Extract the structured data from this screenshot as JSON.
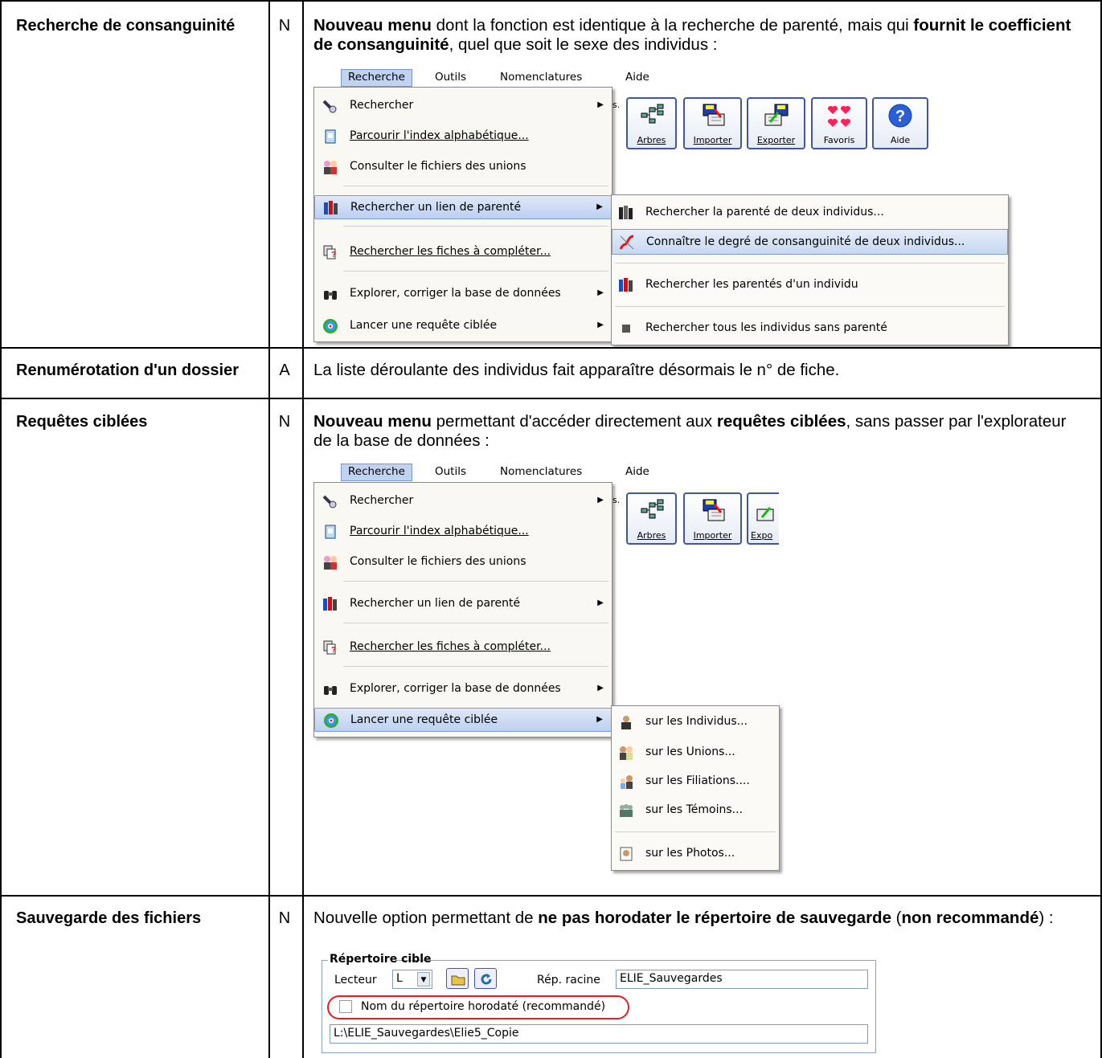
{
  "rows": [
    {
      "feature": "Recherche de consanguinité",
      "code": "N",
      "desc": {
        "b1": "Nouveau menu",
        "t1": " dont la fonction est identique à la recherche de parenté, mais qui ",
        "b2": "fournit le coefficient de consanguinité",
        "t2": ", quel que soit le sexe des individus :"
      }
    },
    {
      "feature": "Renumérotation d'un dossier",
      "code": "A",
      "desc": {
        "t1": "La liste déroulante des individus fait apparaître désormais le n° de fiche."
      }
    },
    {
      "feature": "Requêtes ciblées",
      "code": "N",
      "desc": {
        "b1": "Nouveau menu",
        "t1": " permettant d'accéder directement aux ",
        "b2": "requêtes ciblées",
        "t2": ", sans passer par l'explorateur de la base de données :"
      }
    },
    {
      "feature": "Sauvegarde des fichiers",
      "code": "N",
      "desc": {
        "t1": "Nouvelle option permettant de ",
        "b1": "ne pas horodater le répertoire de sauvegarde",
        "t2": " (",
        "b2": "non recommandé",
        "t3": ") :"
      }
    }
  ],
  "menubar": {
    "recherche": "Recherche",
    "outils": "Outils",
    "nomenclatures": "Nomenclatures",
    "aide": "Aide"
  },
  "menu": [
    {
      "label": "Rechercher",
      "icon": "flashlight-icon"
    },
    {
      "label": "Parcourir l'index alphabétique...",
      "icon": "index-card-icon"
    },
    {
      "label": "Consulter le fichiers des unions",
      "icon": "couple-icon"
    },
    {
      "label": "Rechercher un lien de parenté",
      "icon": "family-icon"
    },
    {
      "label": "Rechercher les fiches à compléter...",
      "icon": "incomplete-cards-icon"
    },
    {
      "label": "Explorer, corriger la base de données",
      "icon": "binoculars-icon"
    },
    {
      "label": "Lancer une requête ciblée",
      "icon": "target-icon"
    }
  ],
  "toolbar": [
    {
      "label": "Arbres",
      "icon": "tree-icon"
    },
    {
      "label": "Importer",
      "icon": "import-icon"
    },
    {
      "label": "Exporter",
      "icon": "export-icon"
    },
    {
      "label": "Favoris",
      "icon": "hearts-icon"
    },
    {
      "label": "Aide",
      "icon": "help-icon"
    }
  ],
  "toolbar_partial": "s.",
  "toolbar2_partial_export": "Expo",
  "submenu_parente": [
    {
      "label": "Rechercher la parenté de deux individus...",
      "icon": "family-icon"
    },
    {
      "label": "Connaître le degré de consanguinité de deux individus...",
      "icon": "consanguinity-icon"
    },
    {
      "label": "Rechercher les parentés d'un individu",
      "icon": "family-icon"
    },
    {
      "label": "Rechercher tous les individus sans parenté",
      "icon": "square-icon"
    }
  ],
  "submenu_requete": [
    {
      "label": "sur les Individus...",
      "icon": "person-icon"
    },
    {
      "label": "sur les Unions...",
      "icon": "couple-icon"
    },
    {
      "label": "sur les Filiations....",
      "icon": "child-icon"
    },
    {
      "label": "sur les Témoins...",
      "icon": "group-icon"
    },
    {
      "label": "sur les Photos...",
      "icon": "photo-icon"
    }
  ],
  "backup": {
    "group_title": "Répertoire cible",
    "lecteur_label": "Lecteur",
    "lecteur_value": "L",
    "rep_racine_label": "Rép. racine",
    "rep_racine_value": "ELIE_Sauvegardes",
    "checkbox_label": "Nom du répertoire horodaté (recommandé)",
    "path_value": "L:\\ELIE_Sauvegardes\\Elie5_Copie"
  },
  "colors": {
    "menu_highlight": "#c2d3f2",
    "border": "#000000",
    "accent": "#3d57a3",
    "red_oval": "#e02020"
  }
}
